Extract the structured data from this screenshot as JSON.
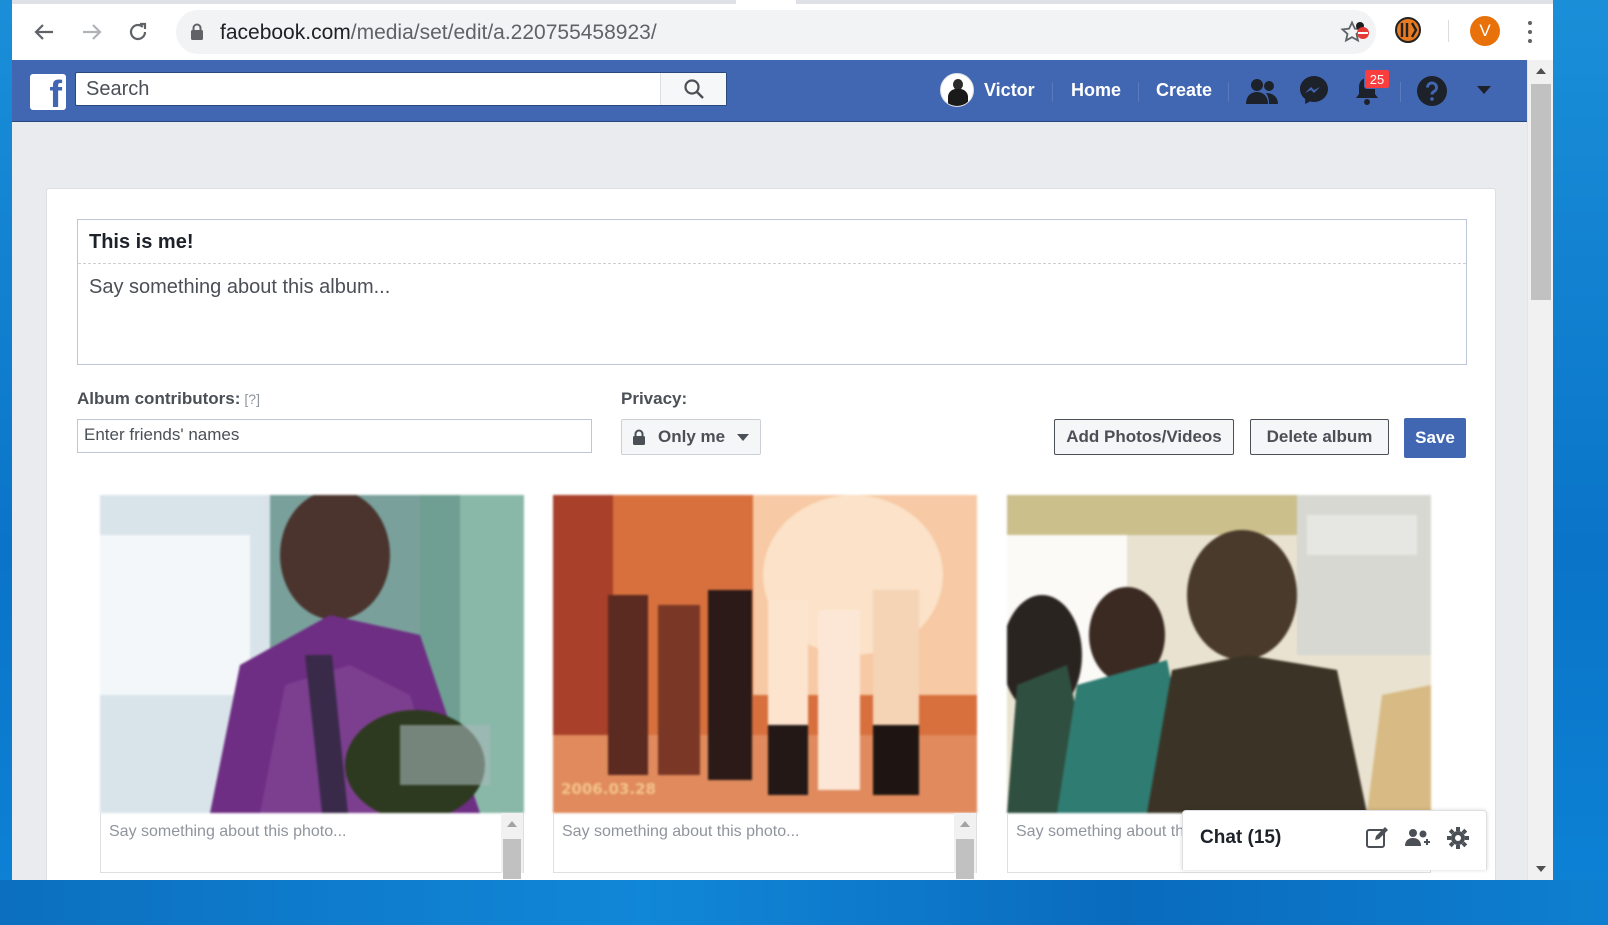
{
  "browser": {
    "url_host": "facebook.com",
    "url_path": "/media/set/edit/a.220755458923/",
    "profile_initial": "V"
  },
  "fb_header": {
    "search_placeholder": "Search",
    "user_name": "Victor",
    "home_label": "Home",
    "create_label": "Create",
    "notification_count": "25"
  },
  "album": {
    "title": "This is me!",
    "description_placeholder": "Say something about this album...",
    "contributors_label": "Album contributors:",
    "contributors_help": "[?]",
    "contributors_placeholder": "Enter friends' names",
    "privacy_label": "Privacy:",
    "privacy_value": "Only me",
    "add_button": "Add Photos/Videos",
    "delete_button": "Delete album",
    "save_button": "Save"
  },
  "photos": [
    {
      "caption_placeholder": "Say something about this photo...",
      "date_stamp": ""
    },
    {
      "caption_placeholder": "Say something about this photo...",
      "date_stamp": "2006.03.28"
    },
    {
      "caption_placeholder": "Say something about this photo...",
      "date_stamp": ""
    }
  ],
  "chat": {
    "label": "Chat (15)"
  },
  "colors": {
    "fb_blue": "#4267b2",
    "notification_red": "#fa3e3e",
    "profile_orange": "#e8710a"
  }
}
